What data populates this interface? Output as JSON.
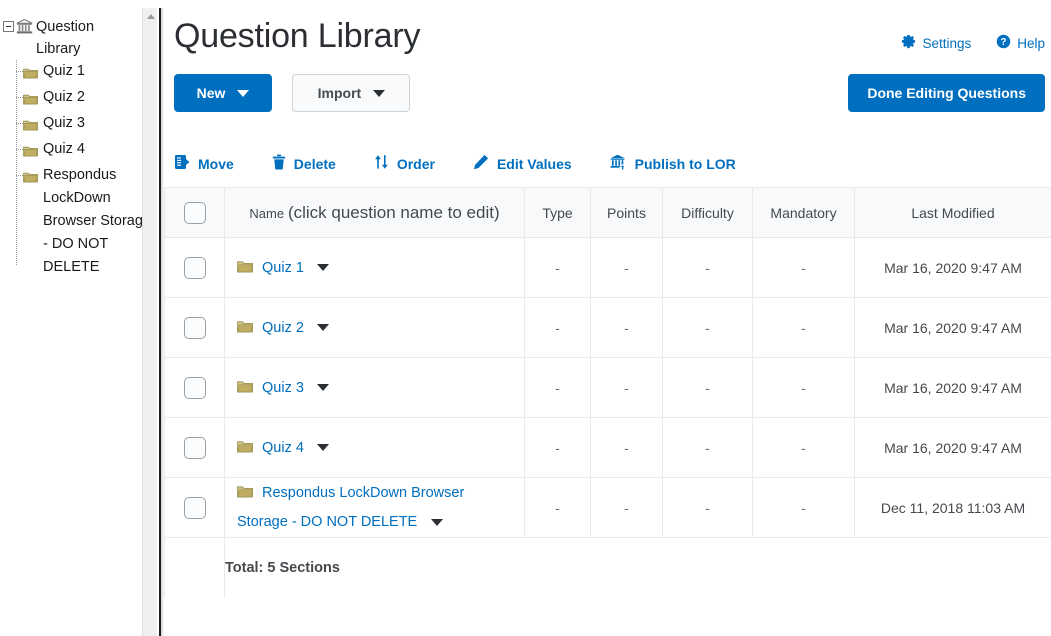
{
  "sidebar": {
    "root": {
      "label": "Question Library",
      "icon": "bank-icon",
      "expander": "minus"
    },
    "items": [
      {
        "label": "Quiz 1",
        "icon": "folder-icon"
      },
      {
        "label": "Quiz 2",
        "icon": "folder-icon"
      },
      {
        "label": "Quiz 3",
        "icon": "folder-icon"
      },
      {
        "label": "Quiz 4",
        "icon": "folder-icon"
      },
      {
        "label": "Respondus LockDown Browser Storage - DO NOT DELETE",
        "icon": "folder-icon"
      }
    ]
  },
  "header": {
    "title": "Question Library",
    "settings_label": "Settings",
    "settings_icon": "gear-icon",
    "help_label": "Help",
    "help_icon": "question-circle-icon"
  },
  "actions": {
    "new_label": "New",
    "import_label": "Import",
    "done_label": "Done Editing Questions"
  },
  "toolbar": [
    {
      "label": "Move",
      "icon": "move-list-icon"
    },
    {
      "label": "Delete",
      "icon": "trash-icon"
    },
    {
      "label": "Order",
      "icon": "sort-arrows-icon"
    },
    {
      "label": "Edit Values",
      "icon": "pencil-icon"
    },
    {
      "label": "Publish to LOR",
      "icon": "bank-upload-icon"
    }
  ],
  "table": {
    "columns": {
      "name_label_small": "Name",
      "name_label_big": "(click question name to edit)",
      "type": "Type",
      "points": "Points",
      "difficulty": "Difficulty",
      "mandatory": "Mandatory",
      "last_modified": "Last Modified"
    },
    "rows": [
      {
        "name": "Quiz 1",
        "name_line2": "",
        "type": "-",
        "points": "-",
        "difficulty": "-",
        "mandatory": "-",
        "last_modified": "Mar 16, 2020 9:47 AM"
      },
      {
        "name": "Quiz 2",
        "name_line2": "",
        "type": "-",
        "points": "-",
        "difficulty": "-",
        "mandatory": "-",
        "last_modified": "Mar 16, 2020 9:47 AM"
      },
      {
        "name": "Quiz 3",
        "name_line2": "",
        "type": "-",
        "points": "-",
        "difficulty": "-",
        "mandatory": "-",
        "last_modified": "Mar 16, 2020 9:47 AM"
      },
      {
        "name": "Quiz 4",
        "name_line2": "",
        "type": "-",
        "points": "-",
        "difficulty": "-",
        "mandatory": "-",
        "last_modified": "Mar 16, 2020 9:47 AM"
      },
      {
        "name": "Respondus LockDown Browser",
        "name_line2": "Storage - DO NOT DELETE",
        "type": "-",
        "points": "-",
        "difficulty": "-",
        "mandatory": "-",
        "last_modified": "Dec 11, 2018 11:03 AM"
      }
    ],
    "total": "Total:  5 Sections"
  },
  "colors": {
    "accent_blue": "#006fbf",
    "link_blue": "#006fbf",
    "folder_gold": "#b9ad6a",
    "header_bg": "#f8f9fb",
    "border": "#e8eaec",
    "text": "#45494d"
  }
}
